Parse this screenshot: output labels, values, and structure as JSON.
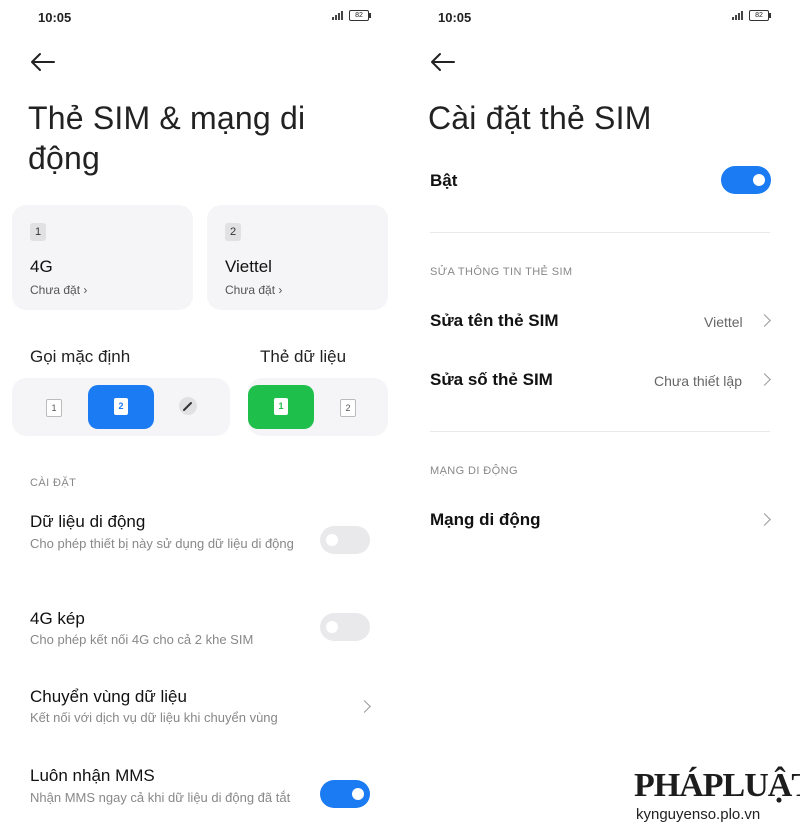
{
  "left": {
    "status": {
      "time": "10:05",
      "battery": "82"
    },
    "title_line1": "Thẻ SIM & mạng di",
    "title_line2": "động",
    "sim_cards": [
      {
        "number": "1",
        "name": "4G",
        "status": "Chưa đặt"
      },
      {
        "number": "2",
        "name": "Viettel",
        "status": "Chưa đặt"
      }
    ],
    "default_call": {
      "label": "Gọi mặc định",
      "options": [
        "1",
        "2"
      ],
      "selected": "2"
    },
    "data_card": {
      "label": "Thẻ dữ liệu",
      "options": [
        "1",
        "2"
      ],
      "selected": "1"
    },
    "settings_header": "CÀI ĐẶT",
    "rows": [
      {
        "title": "Dữ liệu di động",
        "subtitle": "Cho phép thiết bị này sử dụng dữ liệu di động",
        "control": "toggle",
        "on": false
      },
      {
        "title": "4G kép",
        "subtitle": "Cho phép kết nối 4G cho cả 2 khe SIM",
        "control": "toggle",
        "on": false
      },
      {
        "title": "Chuyển vùng dữ liệu",
        "subtitle": "Kết nối với dịch vụ dữ liệu khi chuyển vùng",
        "control": "chevron"
      },
      {
        "title": "Luôn nhận MMS",
        "subtitle": "Nhận MMS ngay cả khi dữ liệu di động đã tắt",
        "control": "toggle",
        "on": true
      }
    ]
  },
  "right": {
    "status": {
      "time": "10:05",
      "battery": "82"
    },
    "title": "Cài đặt thẻ SIM",
    "enable": {
      "label": "Bật",
      "on": true
    },
    "edit_header": "SỬA THÔNG TIN THẺ SIM",
    "edit_rows": [
      {
        "title": "Sửa tên thẻ SIM",
        "value": "Viettel"
      },
      {
        "title": "Sửa số thẻ SIM",
        "value": "Chưa thiết lập"
      }
    ],
    "network_header": "MẠNG DI ĐỘNG",
    "network_row": {
      "title": "Mạng di động"
    }
  },
  "watermark": {
    "logo": "PHÁPLUẬT",
    "url": "kynguyenso.plo.vn"
  },
  "colors": {
    "accent": "#1b7bf2",
    "green": "#1fbf4c",
    "card_bg": "#f5f5f7"
  },
  "icons": {
    "back": "arrow-left-icon",
    "edit": "pencil-icon",
    "chevron": "chevron-right-icon"
  }
}
